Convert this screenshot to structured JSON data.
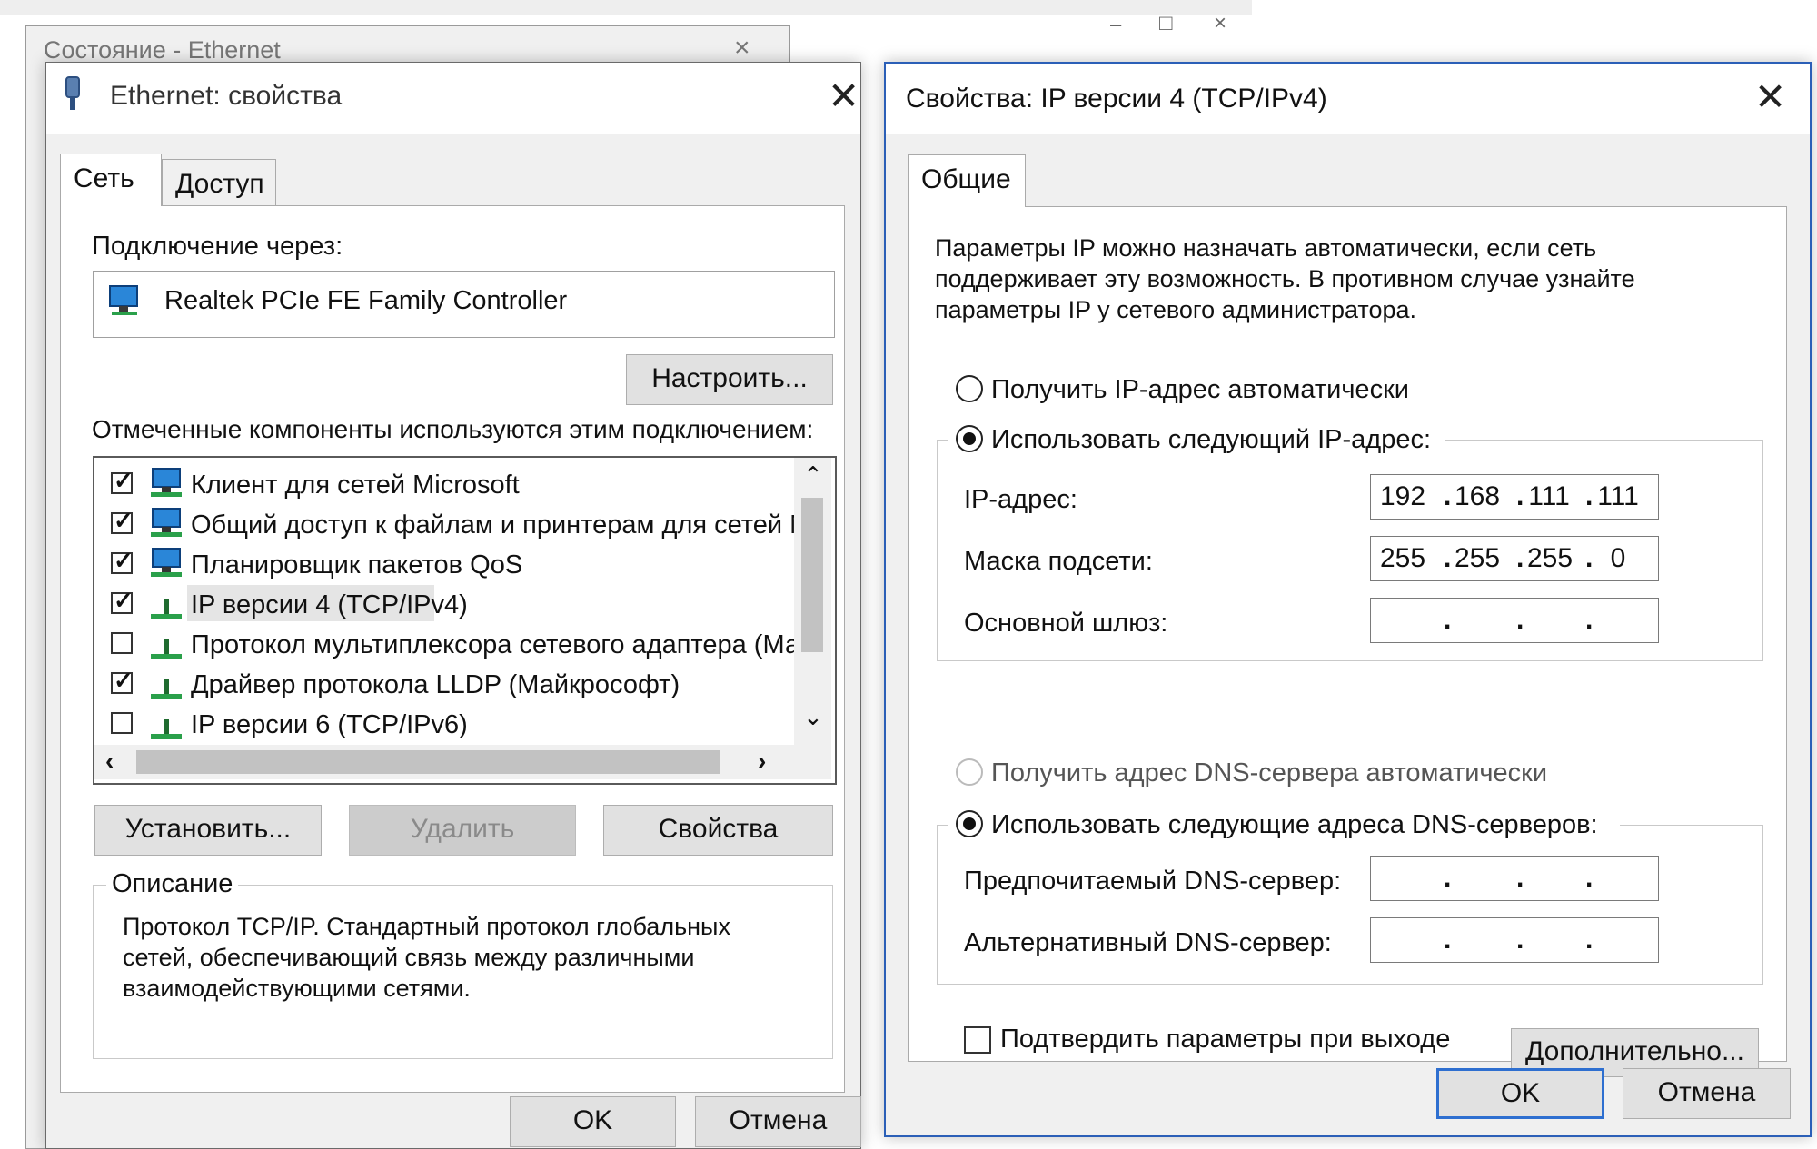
{
  "background_window": {
    "title": "Состояние - Ethernet",
    "minimize": "–",
    "maximize": "□",
    "close": "×"
  },
  "ethernet_dialog": {
    "title": "Ethernet: свойства",
    "close": "✕",
    "tabs": [
      "Сеть",
      "Доступ"
    ],
    "connect_using_label": "Подключение через:",
    "adapter_name": "Realtek PCIe FE Family Controller",
    "configure_button": "Настроить...",
    "components_label": "Отмеченные компоненты используются этим подключением:",
    "components": [
      {
        "label": "Клиент для сетей Microsoft",
        "checked": true,
        "icon": "network-client-icon"
      },
      {
        "label": "Общий доступ к файлам и принтерам для сетей Mi",
        "checked": true,
        "icon": "network-client-icon"
      },
      {
        "label": "Планировщик пакетов QoS",
        "checked": true,
        "icon": "network-client-icon"
      },
      {
        "label": "IP версии 4 (TCP/IPv4)",
        "checked": true,
        "icon": "protocol-icon",
        "selected": true
      },
      {
        "label": "Протокол мультиплексора сетевого адаптера (Май",
        "checked": false,
        "icon": "protocol-icon"
      },
      {
        "label": "Драйвер протокола LLDP (Майкрософт)",
        "checked": true,
        "icon": "protocol-icon"
      },
      {
        "label": "IP версии 6 (TCP/IPv6)",
        "checked": false,
        "icon": "protocol-icon"
      }
    ],
    "install_button": "Установить...",
    "uninstall_button": "Удалить",
    "properties_button": "Свойства",
    "description_label": "Описание",
    "description_lines": [
      "Протокол TCP/IP. Стандартный протокол глобальных",
      "сетей, обеспечивающий связь между различными",
      "взаимодействующими сетями."
    ],
    "ok_button": "OK",
    "cancel_button": "Отмена"
  },
  "ipv4_dialog": {
    "title": "Свойства: IP версии 4 (TCP/IPv4)",
    "close": "✕",
    "tab": "Общие",
    "intro_lines": [
      "Параметры IP можно назначать автоматически, если сеть",
      "поддерживает эту возможность. В противном случае узнайте",
      "параметры IP у сетевого администратора."
    ],
    "auto_ip_label": "Получить IP-адрес автоматически",
    "manual_ip_label": "Использовать следующий IP-адрес:",
    "ip_address_label": "IP-адрес:",
    "ip_address": [
      "192",
      "168",
      "111",
      "111"
    ],
    "subnet_label": "Маска подсети:",
    "subnet_mask": [
      "255",
      "255",
      "255",
      "0"
    ],
    "gateway_label": "Основной шлюз:",
    "gateway": [
      "",
      "",
      "",
      ""
    ],
    "auto_dns_label": "Получить адрес DNS-сервера автоматически",
    "manual_dns_label": "Использовать следующие адреса DNS-серверов:",
    "preferred_dns_label": "Предпочитаемый DNS-сервер:",
    "preferred_dns": [
      "",
      "",
      "",
      ""
    ],
    "alternate_dns_label": "Альтернативный DNS-сервер:",
    "alternate_dns": [
      "",
      "",
      "",
      ""
    ],
    "validate_label": "Подтвердить параметры при выходе",
    "advanced_button": "Дополнительно...",
    "ok_button": "OK",
    "cancel_button": "Отмена"
  },
  "colors": {
    "default_button_border": "#2e6fd0",
    "ipv4_frame": "#2b5fb7",
    "selected_row": "#e5e5e5"
  }
}
